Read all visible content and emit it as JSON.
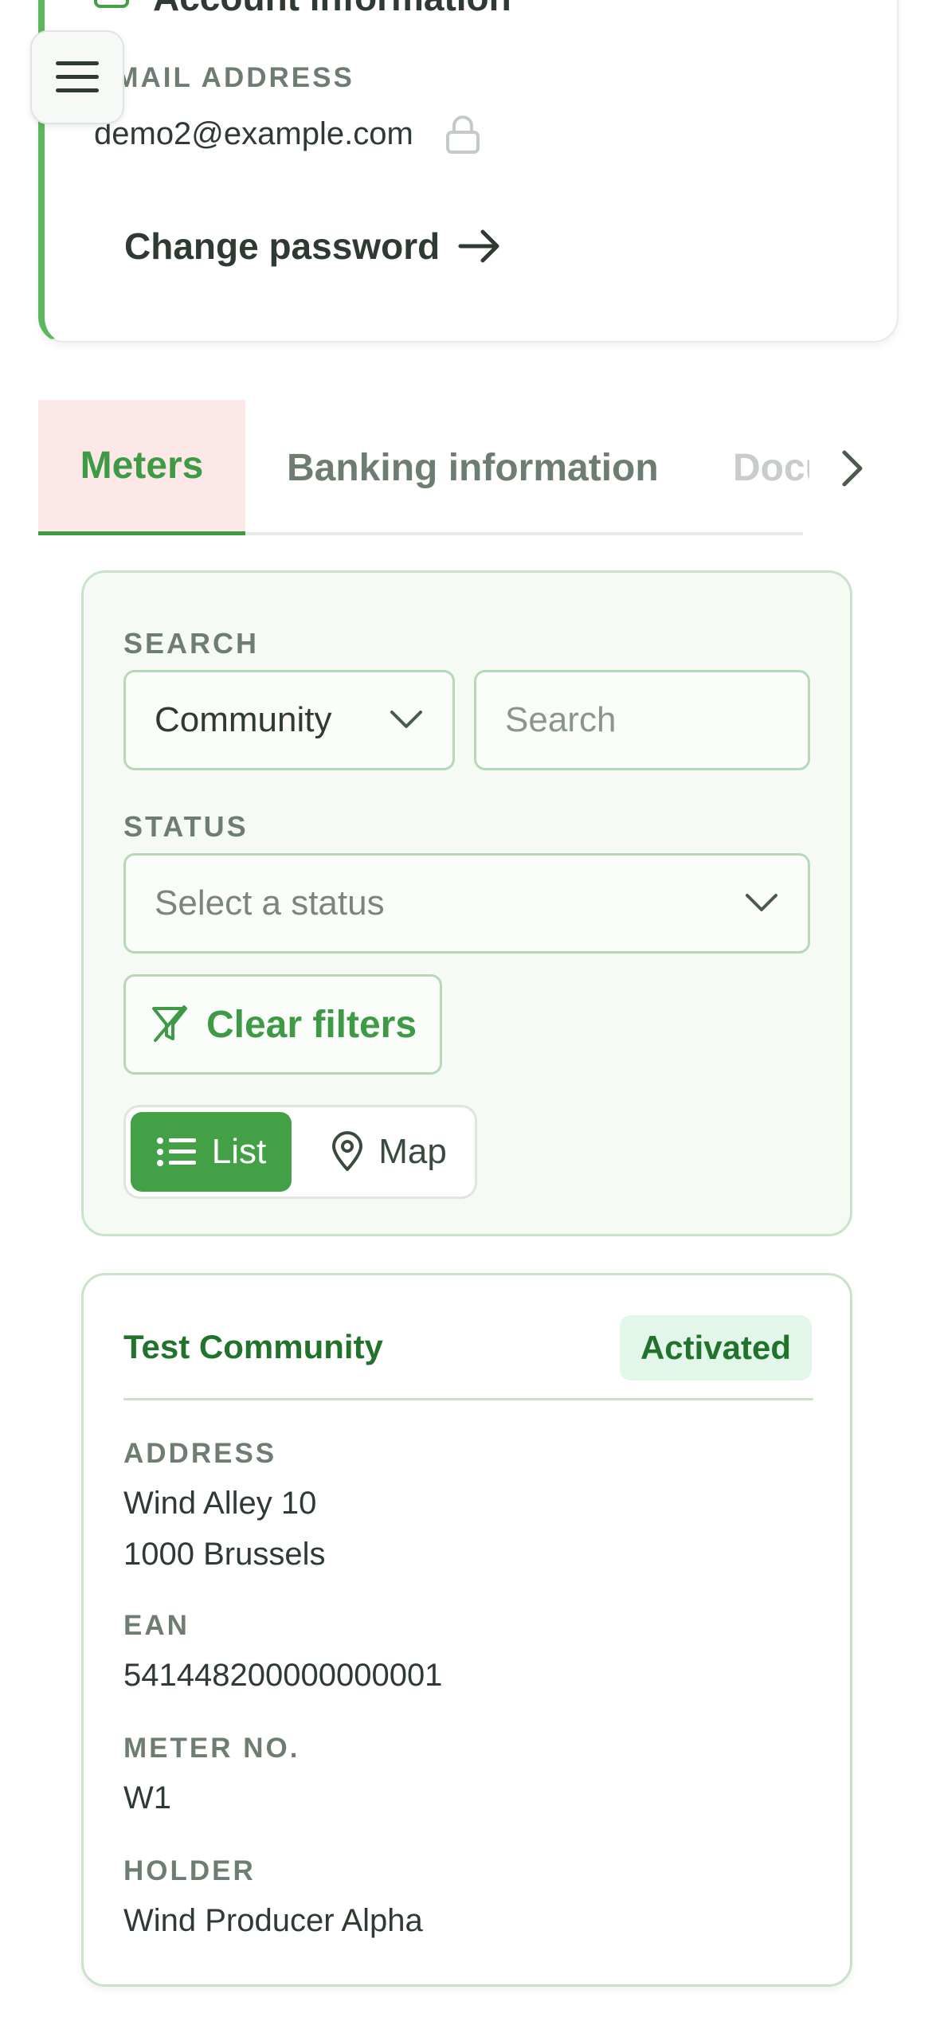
{
  "account": {
    "heading": "Account information",
    "email_label": "EMAIL ADDRESS",
    "email_value": "demo2@example.com",
    "change_password_label": "Change password"
  },
  "tabs": [
    {
      "label": "Meters",
      "active": true
    },
    {
      "label": "Banking information",
      "active": false
    },
    {
      "label": "Documents",
      "active": false
    }
  ],
  "filters": {
    "search_label": "SEARCH",
    "search_field_selected": "Community",
    "search_placeholder": "Search",
    "status_label": "STATUS",
    "status_placeholder": "Select a status",
    "clear_filters_label": "Clear filters",
    "view_toggle": {
      "list_label": "List",
      "map_label": "Map",
      "selected": "List"
    }
  },
  "meter": {
    "name": "Test Community",
    "status": "Activated",
    "address_label": "ADDRESS",
    "address_line1": "Wind Alley 10",
    "address_line2": "1000 Brussels",
    "ean_label": "EAN",
    "ean_value": "541448200000000001",
    "meter_no_label": "METER NO.",
    "meter_no_value": "W1",
    "holder_label": "HOLDER",
    "holder_value": "Wind Producer Alpha"
  },
  "colors": {
    "primary_green": "#43a047",
    "dark_green": "#21722b",
    "panel_background": "#f5faf5",
    "active_tab_background": "#fde8e8",
    "badge_background": "#e3f6ea"
  }
}
